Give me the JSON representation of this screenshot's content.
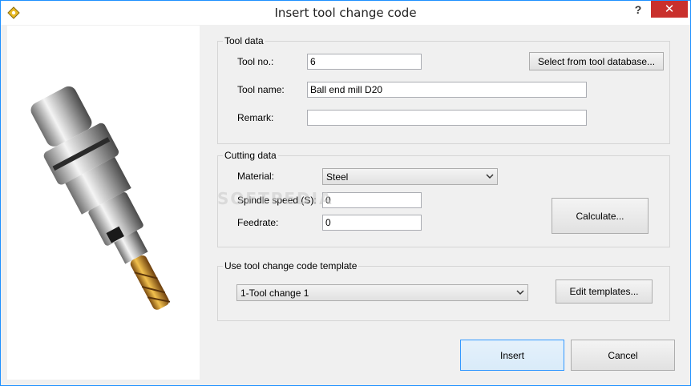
{
  "window": {
    "title": "Insert tool change code",
    "help_label": "?",
    "close_label": "✕"
  },
  "tool_data": {
    "group_title": "Tool data",
    "tool_no_label": "Tool no.:",
    "tool_no_value": "6",
    "select_db_label": "Select from tool database...",
    "tool_name_label": "Tool name:",
    "tool_name_value": "Ball end mill D20",
    "remark_label": "Remark:",
    "remark_value": ""
  },
  "cutting_data": {
    "group_title": "Cutting data",
    "material_label": "Material:",
    "material_value": "Steel",
    "spindle_label": "Spindle speed (S):",
    "spindle_value": "0",
    "feedrate_label": "Feedrate:",
    "feedrate_value": "0",
    "calculate_label": "Calculate..."
  },
  "template": {
    "group_title": "Use tool change code template",
    "selected": "1-Tool change 1",
    "edit_label": "Edit templates..."
  },
  "footer": {
    "insert_label": "Insert",
    "cancel_label": "Cancel"
  },
  "watermark": "SOFTPEDIA",
  "colors": {
    "accent": "#1e90ff",
    "close": "#c9302c"
  }
}
